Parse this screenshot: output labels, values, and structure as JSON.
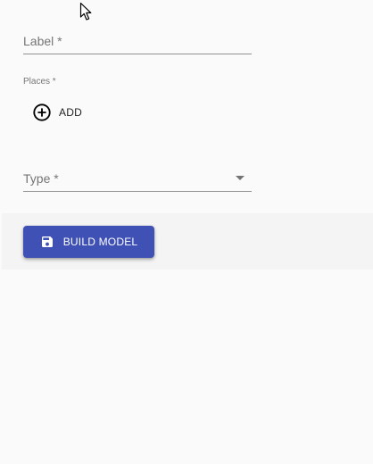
{
  "form": {
    "label_field": {
      "label": "Label *",
      "value": ""
    },
    "places": {
      "label": "Places *",
      "add_button_label": "ADD",
      "add_icon": "add-circle-outline-icon"
    },
    "type_field": {
      "label": "Type *",
      "selected": ""
    }
  },
  "actions": {
    "build_button_label": "BUILD MODEL",
    "build_icon": "save-icon"
  },
  "colors": {
    "primary": "#3f51b5",
    "background": "#fafafa",
    "action_bar": "#f4f4f4"
  }
}
